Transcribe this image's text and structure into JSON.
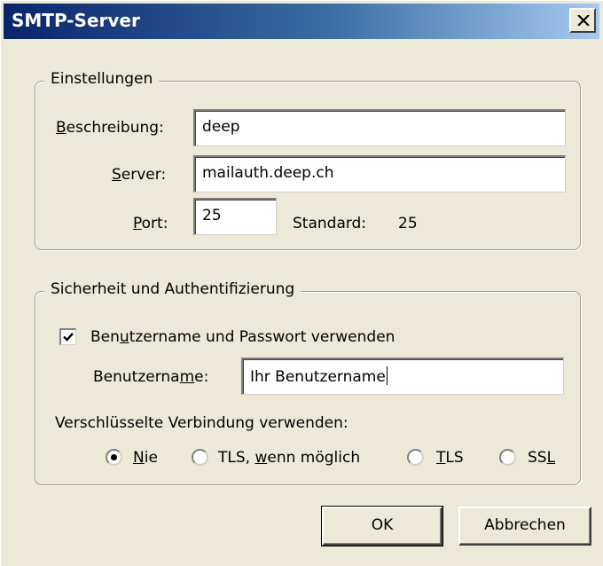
{
  "window": {
    "title": "SMTP-Server",
    "colors": {
      "titlebar_start": "#0a246a",
      "titlebar_end": "#a6caf0",
      "face": "#ece9d8"
    }
  },
  "settings": {
    "legend": "Einstellungen",
    "description": {
      "label_pre": "",
      "label_key": "B",
      "label_post": "eschreibung:",
      "value": "deep"
    },
    "server": {
      "label_pre": "",
      "label_key": "S",
      "label_post": "erver:",
      "value": "mailauth.deep.ch"
    },
    "port": {
      "label_pre": "",
      "label_key": "P",
      "label_post": "ort:",
      "value": "25",
      "default_label": "Standard:",
      "default_value": "25"
    }
  },
  "security": {
    "legend": "Sicherheit und Authentifizierung",
    "use_auth": {
      "checked": true,
      "label_pre": "Ben",
      "label_key": "u",
      "label_post": "tzername und Passwort verwenden"
    },
    "username": {
      "label_pre": "Benutzerna",
      "label_key": "m",
      "label_post": "e:",
      "value": "Ihr Benutzername"
    },
    "encryption": {
      "label": "Verschlüsselte Verbindung verwenden:",
      "selected": "Nie",
      "options": [
        {
          "pre": "",
          "key": "N",
          "post": "ie"
        },
        {
          "pre": "TLS, ",
          "key": "w",
          "post": "enn möglich"
        },
        {
          "pre": "",
          "key": "T",
          "post": "LS"
        },
        {
          "pre": "SS",
          "key": "L",
          "post": ""
        }
      ]
    }
  },
  "buttons": {
    "ok": "OK",
    "cancel": "Abbrechen"
  },
  "icons": {
    "close": "close-icon",
    "check": "checkmark-icon"
  }
}
